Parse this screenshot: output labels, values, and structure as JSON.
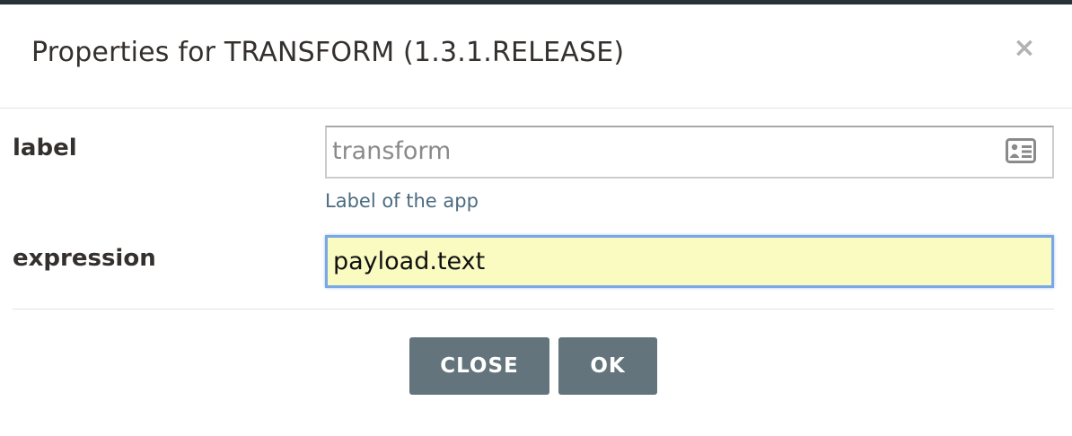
{
  "dialog": {
    "title": "Properties for TRANSFORM (1.3.1.RELEASE)",
    "close_symbol": "×",
    "close_icon": "close-icon"
  },
  "fields": {
    "label": {
      "name": "label",
      "value": "transform",
      "help": "Label of the app",
      "icon": "address-card-icon"
    },
    "expression": {
      "name": "expression",
      "value": "payload.text"
    }
  },
  "buttons": {
    "close": "CLOSE",
    "ok": "OK"
  },
  "colors": {
    "button_bg": "#64747d",
    "focused_field_bg": "#f9fbc1",
    "focus_border": "#7aa7e6",
    "help_text": "#4b6b80"
  }
}
